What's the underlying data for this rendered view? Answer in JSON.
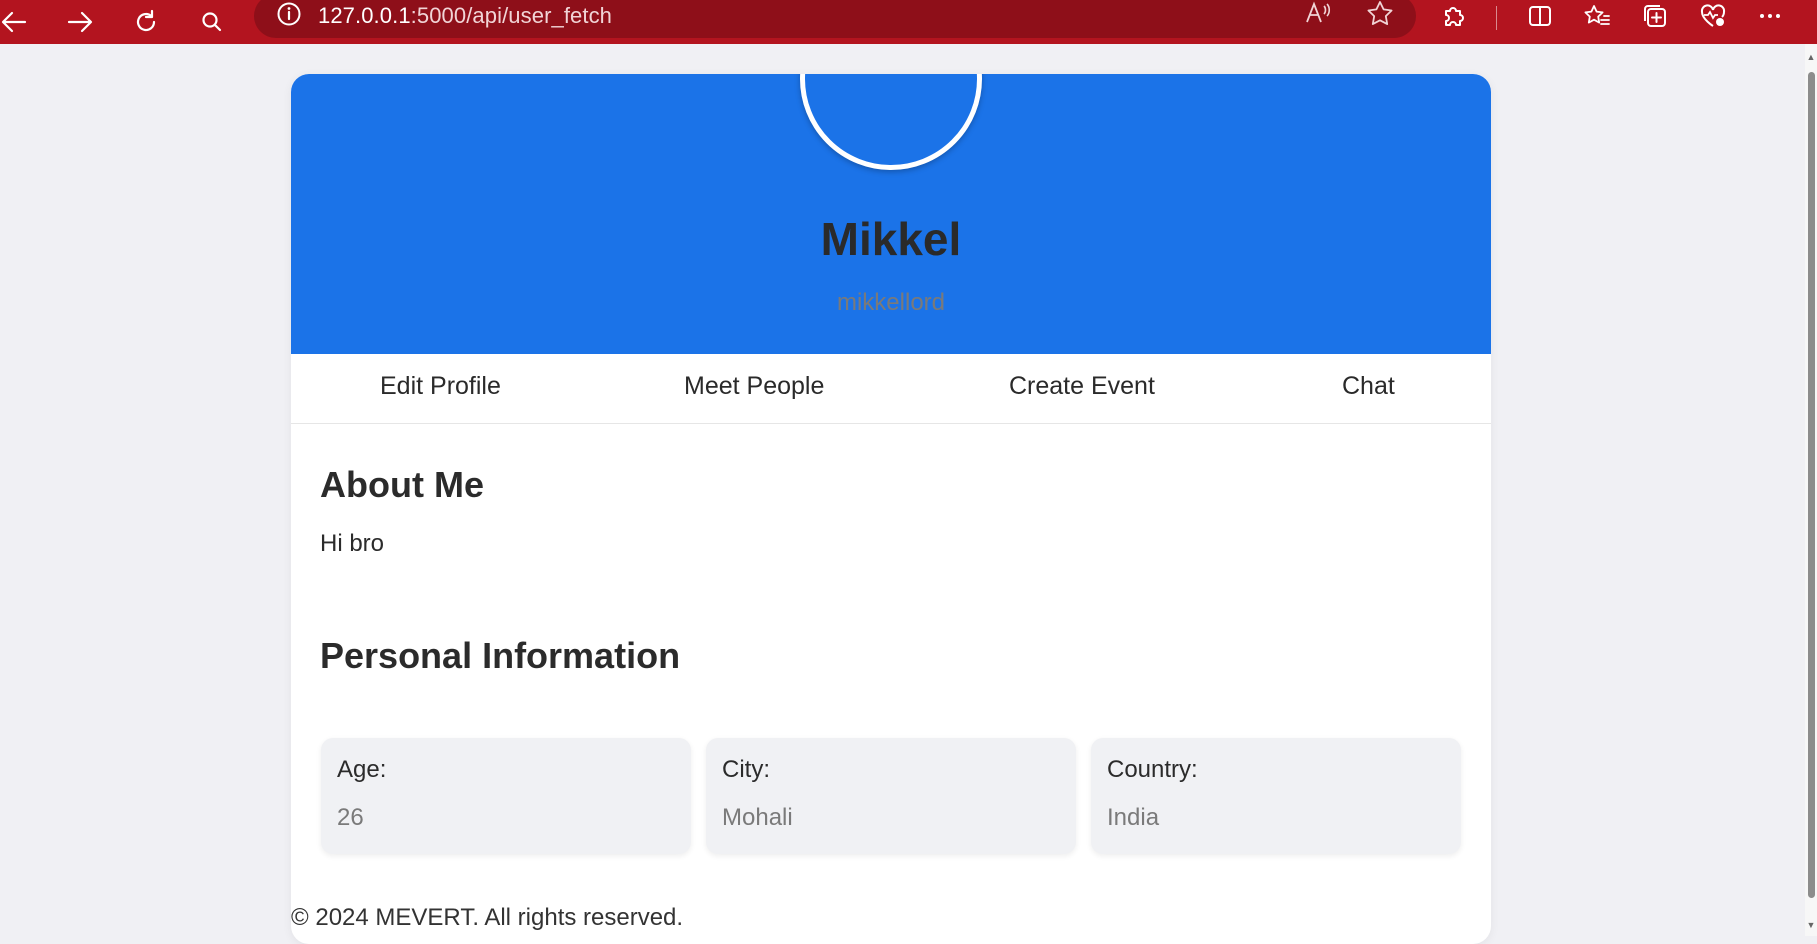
{
  "browser": {
    "url_host": "127.0.0.1",
    "url_path": ":5000/api/user_fetch",
    "icons": [
      "back-arrow-icon",
      "forward-arrow-icon",
      "refresh-icon",
      "search-icon",
      "info-icon",
      "read-aloud-icon",
      "favorite-star-icon",
      "extensions-icon",
      "split-screen-icon",
      "favorites-icon",
      "collections-icon",
      "browser-essentials-icon",
      "more-icon"
    ],
    "accent_color": "#b3141f"
  },
  "profile": {
    "name": "Mikkel",
    "username": "mikkellord",
    "header_color": "#1b73e8"
  },
  "nav": {
    "edit_profile": "Edit Profile",
    "meet_people": "Meet People",
    "create_event": "Create Event",
    "chat": "Chat"
  },
  "about": {
    "title": "About Me",
    "text": "Hi bro"
  },
  "personal": {
    "title": "Personal Information",
    "items": [
      {
        "label": "Age:",
        "value": "26"
      },
      {
        "label": "City:",
        "value": "Mohali"
      },
      {
        "label": "Country:",
        "value": "India"
      }
    ]
  },
  "footer": {
    "text": "© 2024 MEVERT. All rights reserved."
  }
}
